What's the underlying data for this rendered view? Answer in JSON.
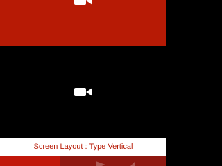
{
  "screen": {
    "layout_label": "Screen Layout : Type Vertical"
  },
  "colors": {
    "top_panel": "#b71a05",
    "main_panel": "#000000",
    "label_background": "#ffffff",
    "label_text": "#b71a05",
    "bottom_left": "#c1180a",
    "bottom_right": "#8f1810",
    "icon": "#ffffff",
    "faded_icon": "#ad5751"
  },
  "icons": {
    "top_video": "video-camera-icon",
    "main_video": "video-camera-icon",
    "bottom_action_a": "play-icon",
    "bottom_action_b": "audio-icon"
  }
}
